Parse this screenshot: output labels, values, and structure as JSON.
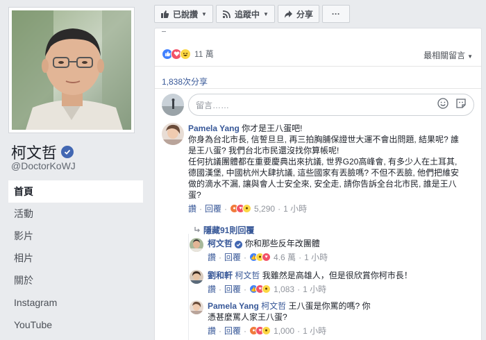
{
  "page": {
    "name": "柯文哲",
    "handle": "@DoctorKoWJ",
    "nav": [
      "首頁",
      "活動",
      "影片",
      "相片",
      "關於",
      "Instagram",
      "YouTube"
    ]
  },
  "actions": {
    "liked": "已說讚",
    "following": "追蹤中",
    "share": "分享",
    "more": "···"
  },
  "reactions": {
    "count": "11 萬"
  },
  "sort_label": "最相關留言",
  "shares": "1,838次分享",
  "composer": {
    "placeholder": "留言……"
  },
  "comments": [
    {
      "author": "Pamela Yang",
      "text": "你才是王八蛋吧!\n你身為台北市長, 信誓旦旦, 再三拍胸脯保證世大運不會出問題, 結果呢? 誰是王八蛋? 我們台北市民還沒找你算帳呢!\n任何抗議團體都在重要慶典出來抗議, 世界G20高峰會, 有多少人在土耳其, 德國漢堡, 中國杭州大肆抗議, 這些國家有丟臉嗎? 不但不丟臉, 他們把維安做的滴水不漏, 讓與會人士安全來, 安全走, 請你告訴全台北市民, 誰是王八蛋?",
      "like": "讚",
      "reply": "回覆",
      "reaction_count": "5,290",
      "time": "1 小時"
    }
  ],
  "hidden_replies": "隱藏91則回覆",
  "replies": [
    {
      "author": "柯文哲",
      "verified": true,
      "tag": "",
      "text": "你和那些反年改團體",
      "like": "讚",
      "reply": "回覆",
      "reaction_count": "4.6 萬",
      "time": "1 小時"
    },
    {
      "author": "劉和軒",
      "verified": false,
      "tag": "柯文哲",
      "text": "我雖然是高雄人，但是很欣賞你柯市長！",
      "like": "讚",
      "reply": "回覆",
      "reaction_count": "1,083",
      "time": "1 小時"
    },
    {
      "author": "Pamela Yang",
      "verified": false,
      "tag": "柯文哲",
      "text": "王八蛋是你罵的嗎? 你憑甚麼罵人家王八蛋?",
      "like": "讚",
      "reply": "回覆",
      "reaction_count": "1,000",
      "time": "1 小時"
    }
  ],
  "colors": {
    "brand": "#4267b2",
    "link": "#385898",
    "bg": "#e9ebee"
  }
}
